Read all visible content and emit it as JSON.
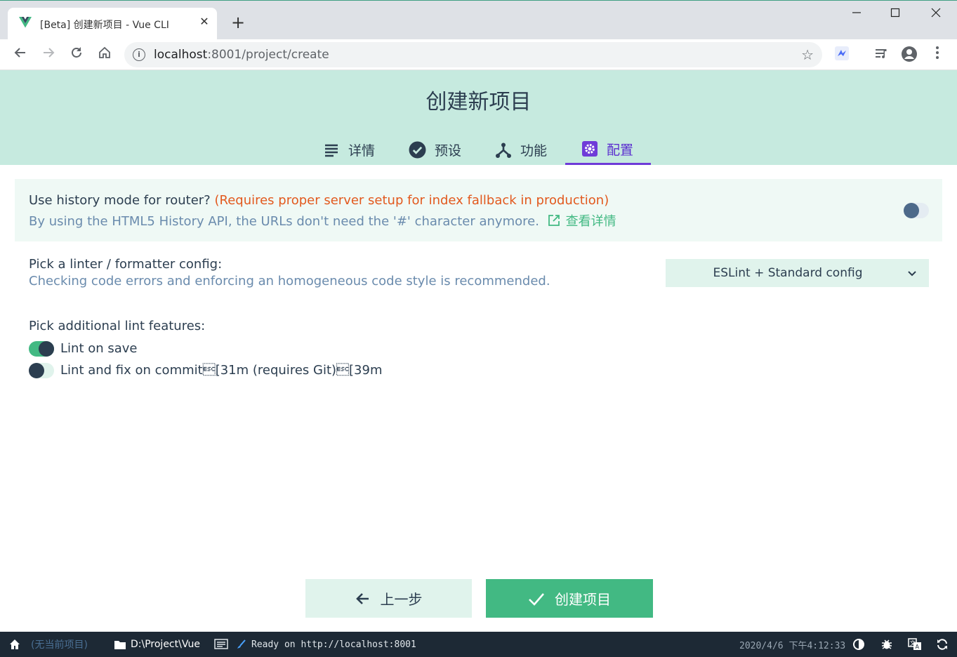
{
  "browser": {
    "tab_title": "[Beta] 创建新项目 - Vue CLI",
    "tab_close": "✕",
    "new_tab": "+",
    "url_host": "localhost",
    "url_rest": ":8001/project/create"
  },
  "header": {
    "title": "创建新项目",
    "tabs": [
      {
        "label": "详情",
        "icon": "list-icon"
      },
      {
        "label": "预设",
        "icon": "check-circle-icon"
      },
      {
        "label": "功能",
        "icon": "fork-icon"
      },
      {
        "label": "配置",
        "icon": "settings-icon",
        "active": true
      }
    ]
  },
  "router": {
    "title": "Use history mode for router?",
    "warning": "(Requires proper server setup for index fallback in production)",
    "description": "By using the HTML5 History API, the URLs don't need the '#' character anymore.",
    "more_link": "查看详情",
    "enabled": false
  },
  "linter": {
    "title": "Pick a linter / formatter config:",
    "description": "Checking code errors and enforcing an homogeneous code style is recommended.",
    "selected": "ESLint + Standard config"
  },
  "lint_features": {
    "title": "Pick additional lint features:",
    "items": [
      {
        "label": "Lint on save",
        "enabled": true
      },
      {
        "label": "Lint and fix on commit\u001b[31m (requires Git)\u001b[39m",
        "enabled": false
      }
    ]
  },
  "actions": {
    "back": "上一步",
    "create": "创建项目"
  },
  "statusbar": {
    "project": "(无当前项目)",
    "folder": "D:\\Project\\Vue",
    "log": "Ready on http://localhost:8001",
    "datetime": "2020/4/6 下午4:12:33"
  },
  "colors": {
    "accent": "#42b983",
    "header_bg": "#c6eadf",
    "active_tab": "#6f3bd8",
    "warning": "#e2591e",
    "statusbar_bg": "#1d2935"
  }
}
